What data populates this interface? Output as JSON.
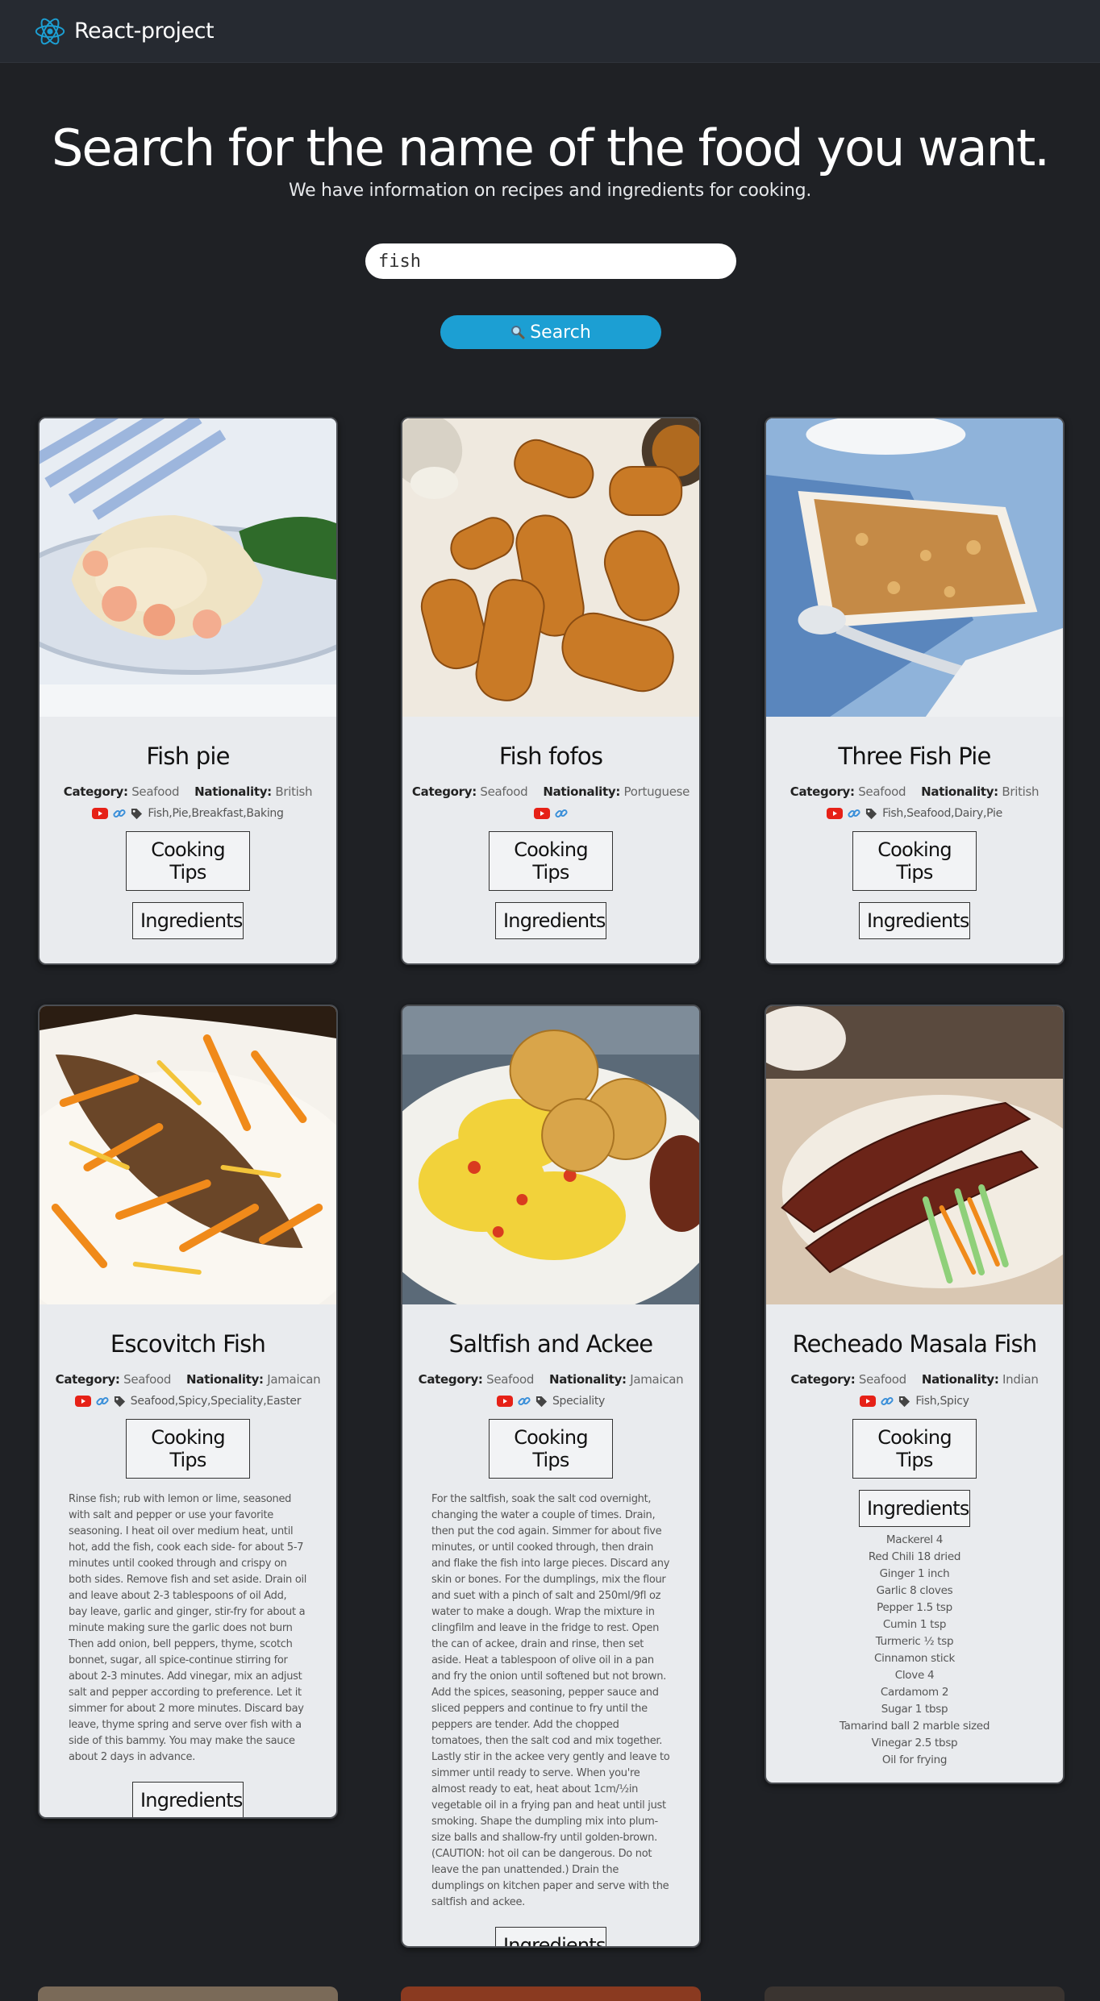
{
  "nav": {
    "brand": "React-project"
  },
  "hero": {
    "title": "Search for the name of the food you want.",
    "subtitle": "We have information on recipes and ingredients for cooking."
  },
  "search": {
    "value": "fish",
    "button_label": "Search",
    "button_icon": "magnifier-icon"
  },
  "labels": {
    "category": "Category:",
    "nationality": "Nationality:",
    "cooking_tips": "Cooking Tips",
    "ingredients": "Ingredients"
  },
  "colors": {
    "background": "#1f2125",
    "navbar": "#262a31",
    "accent": "#1c9fd3",
    "card": "#e9ebee",
    "youtube": "#e62117",
    "link": "#3a8fd9"
  },
  "cards": [
    {
      "title": "Fish pie",
      "category": "Seafood",
      "nationality": "British",
      "tags": "Fish,Pie,Breakfast,Baking"
    },
    {
      "title": "Fish fofos",
      "category": "Seafood",
      "nationality": "Portuguese",
      "tags": ""
    },
    {
      "title": "Three Fish Pie",
      "category": "Seafood",
      "nationality": "British",
      "tags": "Fish,Seafood,Dairy,Pie"
    },
    {
      "title": "Escovitch Fish",
      "category": "Seafood",
      "nationality": "Jamaican",
      "tags": "Seafood,Spicy,Speciality,Easter",
      "instructions": "Rinse fish; rub with lemon or lime, seasoned with salt and pepper or use your favorite seasoning. I heat oil over medium heat, until hot, add the fish, cook each side- for about 5-7 minutes until cooked through and crispy on both sides. Remove fish and set aside. Drain oil and leave about 2-3 tablespoons of oil Add, bay leave, garlic and ginger, stir-fry for about a minute making sure the garlic does not burn Then add onion, bell peppers, thyme, scotch bonnet, sugar, all spice-continue stirring for about 2-3 minutes. Add vinegar, mix an adjust salt and pepper according to preference. Let it simmer for about 2 more minutes. Discard bay leave, thyme spring and serve over fish with a side of this bammy. You may make the sauce about 2 days in advance."
    },
    {
      "title": "Saltfish and Ackee",
      "category": "Seafood",
      "nationality": "Jamaican",
      "tags": "Speciality",
      "instructions": "For the saltfish, soak the salt cod overnight, changing the water a couple of times. Drain, then put the cod again. Simmer for about five minutes, or until cooked through, then drain and flake the fish into large pieces. Discard any skin or bones. For the dumplings, mix the flour and suet with a pinch of salt and 250ml/9fl oz water to make a dough. Wrap the mixture in clingfilm and leave in the fridge to rest. Open the can of ackee, drain and rinse, then set aside. Heat a tablespoon of olive oil in a pan and fry the onion until softened but not brown. Add the spices, seasoning, pepper sauce and sliced peppers and continue to fry until the peppers are tender. Add the chopped tomatoes, then the salt cod and mix together. Lastly stir in the ackee very gently and leave to simmer until ready to serve. When you're almost ready to eat, heat about 1cm/½in vegetable oil in a frying pan and heat until just smoking. Shape the dumpling mix into plum-size balls and shallow-fry until golden-brown. (CAUTION: hot oil can be dangerous. Do not leave the pan unattended.) Drain the dumplings on kitchen paper and serve with the saltfish and ackee."
    },
    {
      "title": "Recheado Masala Fish",
      "category": "Seafood",
      "nationality": "Indian",
      "tags": "Fish,Spicy",
      "ingredients": [
        "Mackerel 4",
        "Red Chili 18 dried",
        "Ginger 1 inch",
        "Garlic 8 cloves",
        "Pepper 1.5 tsp",
        "Cumin 1 tsp",
        "Turmeric ½ tsp",
        "Cinnamon stick",
        "Clove 4",
        "Cardamom 2",
        "Sugar 1 tbsp",
        "Tamarind ball 2 marble sized",
        "Vinegar 2.5 tbsp",
        "Oil for frying"
      ]
    }
  ]
}
